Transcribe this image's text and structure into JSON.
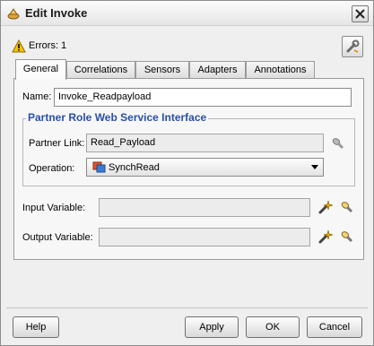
{
  "window": {
    "title": "Edit Invoke"
  },
  "errors": {
    "label": "Errors: 1"
  },
  "tabs": [
    {
      "label": "General"
    },
    {
      "label": "Correlations"
    },
    {
      "label": "Sensors"
    },
    {
      "label": "Adapters"
    },
    {
      "label": "Annotations"
    }
  ],
  "general": {
    "name_label": "Name:",
    "name_value": "Invoke_Readpayload",
    "group_title": "Partner Role Web Service Interface",
    "partner_link_label": "Partner Link:",
    "partner_link_value": "Read_Payload",
    "operation_label": "Operation:",
    "operation_value": "SynchRead",
    "input_variable_label": "Input Variable:",
    "input_variable_value": "",
    "output_variable_label": "Output Variable:",
    "output_variable_value": ""
  },
  "buttons": {
    "help": "Help",
    "apply": "Apply",
    "ok": "OK",
    "cancel": "Cancel"
  },
  "colors": {
    "group_title": "#2a4fa8",
    "warning": "#f5c400"
  },
  "icons": [
    "invoke-icon",
    "close-icon",
    "warning-icon",
    "wrench-icon",
    "flashlight-icon",
    "operation-icon",
    "create-variable-icon",
    "browse-variable-icon"
  ]
}
